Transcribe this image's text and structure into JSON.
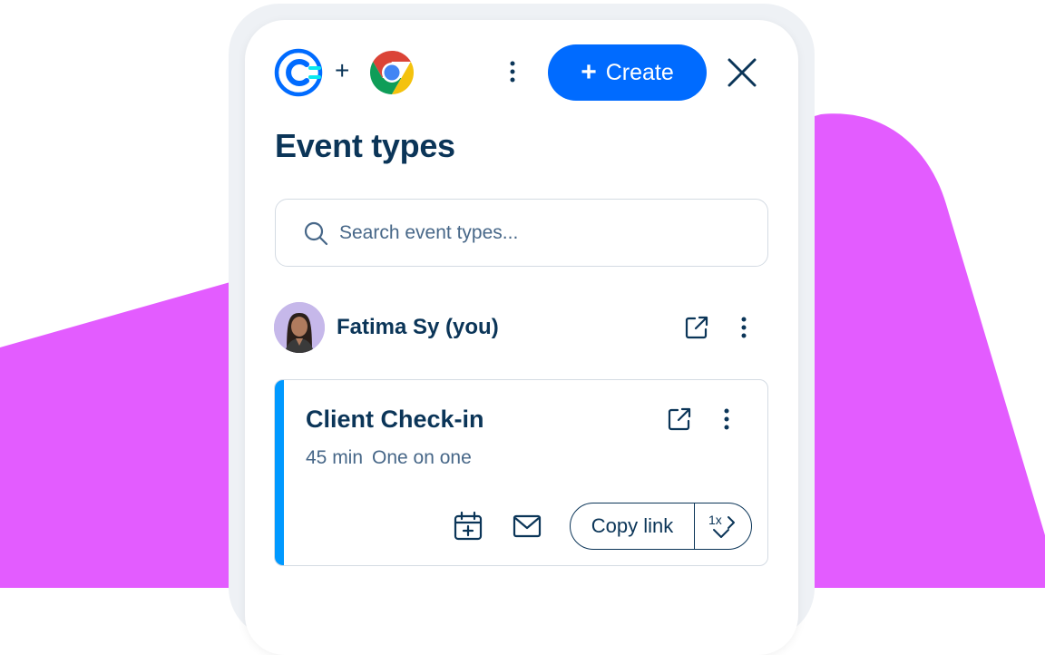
{
  "app": {
    "brand_icon": "calendly-c-icon",
    "connector_text": "+",
    "browser_icon": "chrome-icon",
    "create_button_label": "Create",
    "accent_color": "#006bff",
    "background_shape_color": "#e35cff"
  },
  "page": {
    "title": "Event types"
  },
  "search": {
    "placeholder": "Search event types..."
  },
  "user": {
    "name": "Fatima Sy (you)"
  },
  "event_card": {
    "title": "Client Check-in",
    "duration": "45 min",
    "type": "One on one",
    "accent_color": "#0099ff",
    "copy_link_label": "Copy link",
    "single_use_label": "1x"
  }
}
